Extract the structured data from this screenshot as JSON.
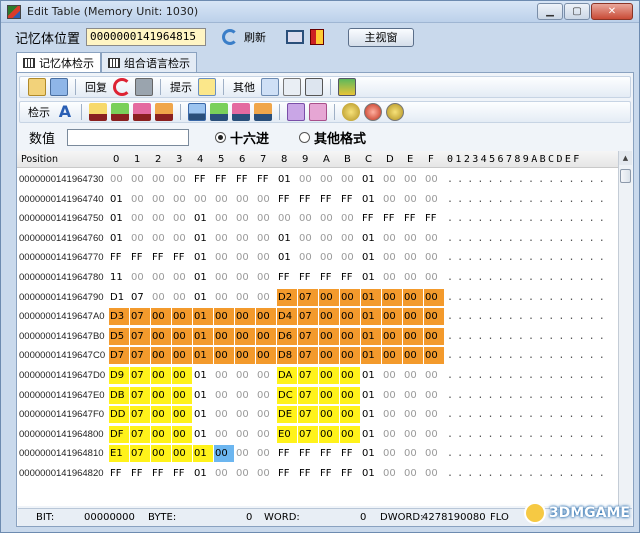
{
  "window": {
    "title": "Edit Table (Memory Unit: 1030)"
  },
  "toolbar_top": {
    "address_label": "记忆体位置",
    "address_value": "0000000141964815",
    "refresh_label": "刷新",
    "main_window_label": "主视窗"
  },
  "tabs": [
    {
      "label": "记忆体检示"
    },
    {
      "label": "组合语言检示"
    }
  ],
  "toolbar1": {
    "restore_label": "回复",
    "hint_label": "提示",
    "other_label": "其他"
  },
  "toolbar2": {
    "view_label": "检示",
    "icon_tags": [
      "DEC",
      "DEC",
      "DEC",
      "DEC",
      "HEX",
      "HEX",
      "HEX",
      "HEX"
    ]
  },
  "value_row": {
    "label": "数值",
    "value": "",
    "radio_hex": "十六进",
    "radio_other": "其他格式",
    "selected": "hex"
  },
  "grid": {
    "position_header": "Position",
    "byte_headers": [
      "0",
      "1",
      "2",
      "3",
      "4",
      "5",
      "6",
      "7",
      "8",
      "9",
      "A",
      "B",
      "C",
      "D",
      "E",
      "F"
    ],
    "ascii_header": "0123456789ABCDEF",
    "rows": [
      {
        "addr": "0000000141964730",
        "bytes": [
          "00",
          "00",
          "00",
          "00",
          "FF",
          "FF",
          "FF",
          "FF",
          "01",
          "00",
          "00",
          "00",
          "01",
          "00",
          "00",
          "00"
        ]
      },
      {
        "addr": "0000000141964740",
        "bytes": [
          "01",
          "00",
          "00",
          "00",
          "00",
          "00",
          "00",
          "00",
          "FF",
          "FF",
          "FF",
          "FF",
          "01",
          "00",
          "00",
          "00"
        ]
      },
      {
        "addr": "0000000141964750",
        "bytes": [
          "01",
          "00",
          "00",
          "00",
          "01",
          "00",
          "00",
          "00",
          "00",
          "00",
          "00",
          "00",
          "FF",
          "FF",
          "FF",
          "FF"
        ]
      },
      {
        "addr": "0000000141964760",
        "bytes": [
          "01",
          "00",
          "00",
          "00",
          "01",
          "00",
          "00",
          "00",
          "01",
          "00",
          "00",
          "00",
          "01",
          "00",
          "00",
          "00"
        ]
      },
      {
        "addr": "0000000141964770",
        "bytes": [
          "FF",
          "FF",
          "FF",
          "FF",
          "01",
          "00",
          "00",
          "00",
          "01",
          "00",
          "00",
          "00",
          "01",
          "00",
          "00",
          "00"
        ]
      },
      {
        "addr": "0000000141964780",
        "bytes": [
          "11",
          "00",
          "00",
          "00",
          "01",
          "00",
          "00",
          "00",
          "FF",
          "FF",
          "FF",
          "FF",
          "01",
          "00",
          "00",
          "00"
        ]
      },
      {
        "addr": "0000000141964790",
        "bytes": [
          "D1",
          "07",
          "00",
          "00",
          "01",
          "00",
          "00",
          "00",
          "D2",
          "07",
          "00",
          "00",
          "01",
          "00",
          "00",
          "00"
        ]
      },
      {
        "addr": "00000001419647A0",
        "bytes": [
          "D3",
          "07",
          "00",
          "00",
          "01",
          "00",
          "00",
          "00",
          "D4",
          "07",
          "00",
          "00",
          "01",
          "00",
          "00",
          "00"
        ]
      },
      {
        "addr": "00000001419647B0",
        "bytes": [
          "D5",
          "07",
          "00",
          "00",
          "01",
          "00",
          "00",
          "00",
          "D6",
          "07",
          "00",
          "00",
          "01",
          "00",
          "00",
          "00"
        ]
      },
      {
        "addr": "00000001419647C0",
        "bytes": [
          "D7",
          "07",
          "00",
          "00",
          "01",
          "00",
          "00",
          "00",
          "D8",
          "07",
          "00",
          "00",
          "01",
          "00",
          "00",
          "00"
        ]
      },
      {
        "addr": "00000001419647D0",
        "bytes": [
          "D9",
          "07",
          "00",
          "00",
          "01",
          "00",
          "00",
          "00",
          "DA",
          "07",
          "00",
          "00",
          "01",
          "00",
          "00",
          "00"
        ]
      },
      {
        "addr": "00000001419647E0",
        "bytes": [
          "DB",
          "07",
          "00",
          "00",
          "01",
          "00",
          "00",
          "00",
          "DC",
          "07",
          "00",
          "00",
          "01",
          "00",
          "00",
          "00"
        ]
      },
      {
        "addr": "00000001419647F0",
        "bytes": [
          "DD",
          "07",
          "00",
          "00",
          "01",
          "00",
          "00",
          "00",
          "DE",
          "07",
          "00",
          "00",
          "01",
          "00",
          "00",
          "00"
        ]
      },
      {
        "addr": "0000000141964800",
        "bytes": [
          "DF",
          "07",
          "00",
          "00",
          "01",
          "00",
          "00",
          "00",
          "E0",
          "07",
          "00",
          "00",
          "01",
          "00",
          "00",
          "00"
        ]
      },
      {
        "addr": "0000000141964810",
        "bytes": [
          "E1",
          "07",
          "00",
          "00",
          "01",
          "00",
          "00",
          "00",
          "FF",
          "FF",
          "FF",
          "FF",
          "01",
          "00",
          "00",
          "00"
        ]
      },
      {
        "addr": "0000000141964820",
        "bytes": [
          "FF",
          "FF",
          "FF",
          "FF",
          "01",
          "00",
          "00",
          "00",
          "FF",
          "FF",
          "FF",
          "FF",
          "01",
          "00",
          "00",
          "00"
        ]
      }
    ],
    "ascii_rows": [
      "................",
      "................",
      "................",
      "................",
      "................",
      "................",
      "................",
      "................",
      "................",
      "................",
      "................",
      "................",
      "................",
      "................",
      "................",
      "................"
    ]
  },
  "statusbar": {
    "bit_label": "BIT:",
    "bit_value": "00000000",
    "byte_label": "BYTE:",
    "byte_value": "0",
    "word_label": "WORD:",
    "word_value": "0",
    "dword_label": "DWORD:",
    "dword_value": "4278190080",
    "float_label": "FLO"
  },
  "watermark": {
    "text": "3DMGAME"
  },
  "colors": {
    "orange": "#f39a2c",
    "yellow": "#fff21a",
    "selected_blue": "#6cb6f0"
  }
}
